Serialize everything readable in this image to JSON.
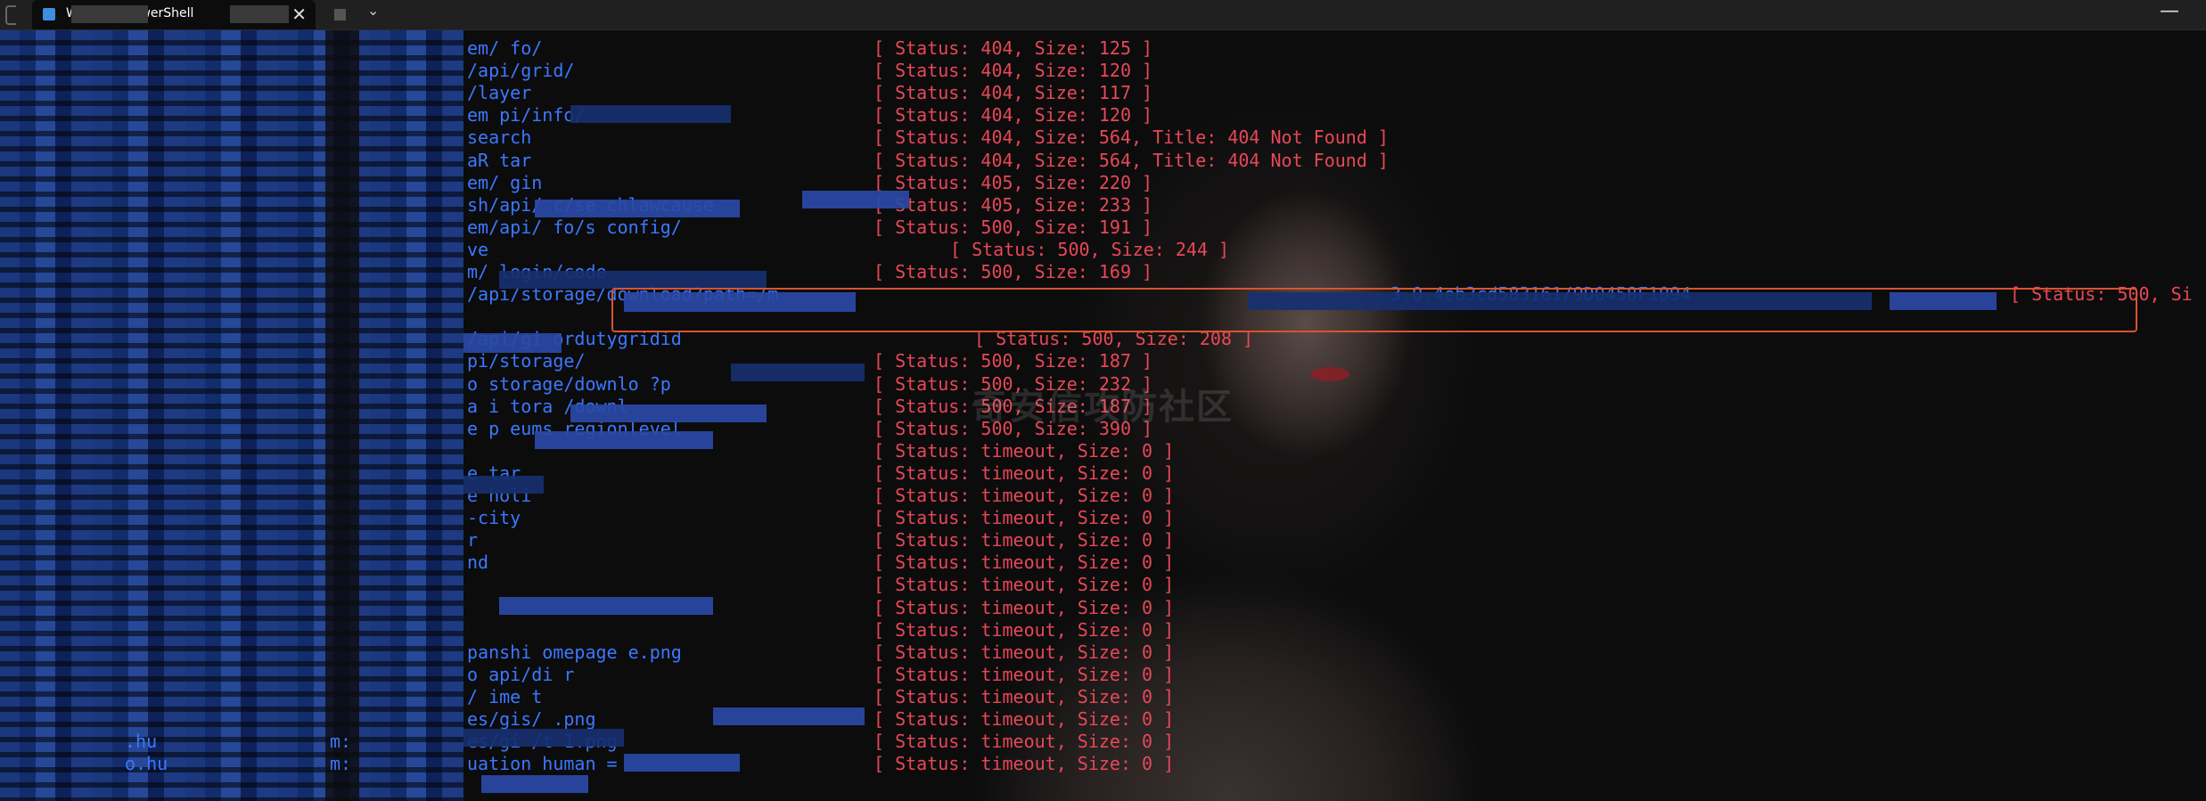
{
  "window": {
    "tab_title": "Windows PowerShell",
    "tab_icon": "powershell-icon",
    "close_glyph": "✕",
    "dropdown_glyph": "⌄",
    "minimize_glyph": "—"
  },
  "watermark": "奇安信攻防社区",
  "colors": {
    "path_text": "#3b78ff",
    "status_text": "#e74856",
    "highlight_box": "#d9542e"
  },
  "terminal": {
    "lines": [
      {
        "path": "em/ fo/",
        "status": "[ Status: 404, Size: 125 ]"
      },
      {
        "path": "/api/grid/",
        "status": "[ Status: 404, Size: 120 ]"
      },
      {
        "path": "/layer",
        "status": "[ Status: 404, Size: 117 ]"
      },
      {
        "path": "em pi/info/",
        "status": "[ Status: 404, Size: 120 ]"
      },
      {
        "path": "search",
        "status": "[ Status: 404, Size: 564, Title: 404 Not Found ]"
      },
      {
        "path": "aR tar",
        "status": "[ Status: 404, Size: 564, Title: 404 Not Found ]"
      },
      {
        "path": "em/ gin",
        "status": "[ Status: 405, Size: 220 ]"
      },
      {
        "path": "sh/api/ c/se chlawcause",
        "status": "[ Status: 405, Size: 233 ]"
      },
      {
        "path": "em/api/ fo/s config/",
        "status": "[ Status: 500, Size: 191 ]"
      },
      {
        "path": "ve",
        "status": "[ Status: 500, Size: 244 ]"
      },
      {
        "path": "m/ login/code",
        "status": "[ Status: 500, Size: 169 ]"
      },
      {
        "path": "/api/storage/download?path=/m",
        "path_tail": "3.0.4eb3cd583161/9D0458F1094",
        "status": "[ Status: 500, Si"
      },
      {
        "path": "",
        "status": ""
      },
      {
        "path": "/api/gi ordutygridid",
        "status": "[ Status: 500, Size: 208 ]"
      },
      {
        "path": "pi/storage/",
        "status": "[ Status: 500, Size: 187 ]"
      },
      {
        "path": "o storage/downlo ?p",
        "status": "[ Status: 500, Size: 232 ]"
      },
      {
        "path": "a i tora /downl",
        "status": "[ Status: 500, Size: 187 ]"
      },
      {
        "path": "e p eums regionlevel",
        "status": "[ Status: 500, Size: 390 ]"
      },
      {
        "path": "",
        "status": "[ Status: timeout, Size: 0 ]"
      },
      {
        "path": "e tar",
        "status": "[ Status: timeout, Size: 0 ]"
      },
      {
        "path": "e holi",
        "status": "[ Status: timeout, Size: 0 ]"
      },
      {
        "path": "-city",
        "status": "[ Status: timeout, Size: 0 ]"
      },
      {
        "path": "r",
        "status": "[ Status: timeout, Size: 0 ]"
      },
      {
        "path": "nd",
        "status": "[ Status: timeout, Size: 0 ]"
      },
      {
        "path": "",
        "status": "[ Status: timeout, Size: 0 ]"
      },
      {
        "path": "",
        "status": "[ Status: timeout, Size: 0 ]"
      },
      {
        "path": "",
        "status": "[ Status: timeout, Size: 0 ]"
      },
      {
        "path": "panshi omepage e.png",
        "status": "[ Status: timeout, Size: 0 ]"
      },
      {
        "path": "o api/di r",
        "status": "[ Status: timeout, Size: 0 ]"
      },
      {
        "path": "/ ime t",
        "status": "[ Status: timeout, Size: 0 ]"
      },
      {
        "path": "es/gis/ .png",
        "status": "[ Status: timeout, Size: 0 ]"
      },
      {
        "path": "es/gi /t 1.png",
        "status": "[ Status: timeout, Size: 0 ]"
      },
      {
        "path": "uation human =",
        "status": "[ Status: timeout, Size: 0 ]"
      }
    ],
    "left_fragments": [
      {
        "text": ".hu",
        "row": 31
      },
      {
        "text": "m:",
        "row": 31
      },
      {
        "text": "o.hu",
        "row": 32
      },
      {
        "text": "m:",
        "row": 32
      }
    ]
  }
}
